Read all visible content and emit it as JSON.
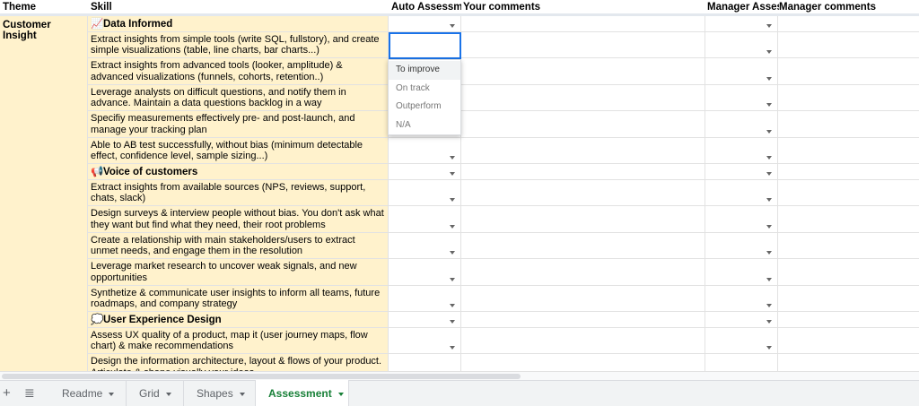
{
  "columns": {
    "theme": "Theme",
    "skill": "Skill",
    "auto_assessment": "Auto Assessment",
    "your_comments": "Your comments",
    "manager_assessment": "Manager Assessment",
    "manager_comments": "Manager comments"
  },
  "theme_label": "Customer Insight",
  "rows": [
    {
      "type": "section",
      "icon": "📈",
      "icon_name": "chart-icon",
      "text": "Data Informed"
    },
    {
      "type": "skill",
      "text": "Extract insights from simple tools (write SQL, fullstory), and create simple visualizations (table, line charts, bar charts...)"
    },
    {
      "type": "skill",
      "text": "Extract insights from advanced tools (looker, amplitude) & advanced visualizations (funnels, cohorts, retention..)"
    },
    {
      "type": "skill",
      "text": "Leverage analysts on difficult questions, and notify them in advance. Maintain a data questions backlog in a way"
    },
    {
      "type": "skill",
      "text": "Specifiy measurements effectively pre- and post-launch, and manage your tracking plan"
    },
    {
      "type": "skill",
      "text": "Able to AB test successfully, without bias (minimum detectable effect, confidence level, sample sizing...)"
    },
    {
      "type": "section",
      "icon": "📢",
      "icon_name": "megaphone-icon",
      "text": "Voice of customers"
    },
    {
      "type": "skill",
      "text": "Extract insights from available sources (NPS, reviews, support, chats, slack)"
    },
    {
      "type": "skill",
      "text": "Design surveys & interview people without bias. You don't ask what they want but find what they need, their root problems"
    },
    {
      "type": "skill",
      "text": "Create a relationship with main stakeholders/users to extract unmet needs, and engage them in the resolution"
    },
    {
      "type": "skill",
      "text": "Leverage market research to uncover weak signals, and new opportunities"
    },
    {
      "type": "skill",
      "text": "Synthetize & communicate user insights to inform all teams, future roadmaps, and company strategy"
    },
    {
      "type": "section",
      "icon": "💭",
      "icon_name": "thought-bubble-icon",
      "text": "User Experience Design"
    },
    {
      "type": "skill",
      "text": "Assess UX quality of a product, map it (user journey maps, flow chart) & make recommendations"
    },
    {
      "type": "skill",
      "text": "Design the information architecture, layout & flows of your product. Articulate & shape visually your ideas"
    }
  ],
  "dropdown_options": [
    "To improve",
    "On track",
    "Outperform",
    "N/A"
  ],
  "tabs": [
    "Readme",
    "Grid",
    "Shapes",
    "Assessment"
  ],
  "active_tab": "Assessment",
  "colors": {
    "skill_fill": "#fff2cc",
    "active_tab_text": "#188038",
    "selection_border": "#1a73e8"
  }
}
